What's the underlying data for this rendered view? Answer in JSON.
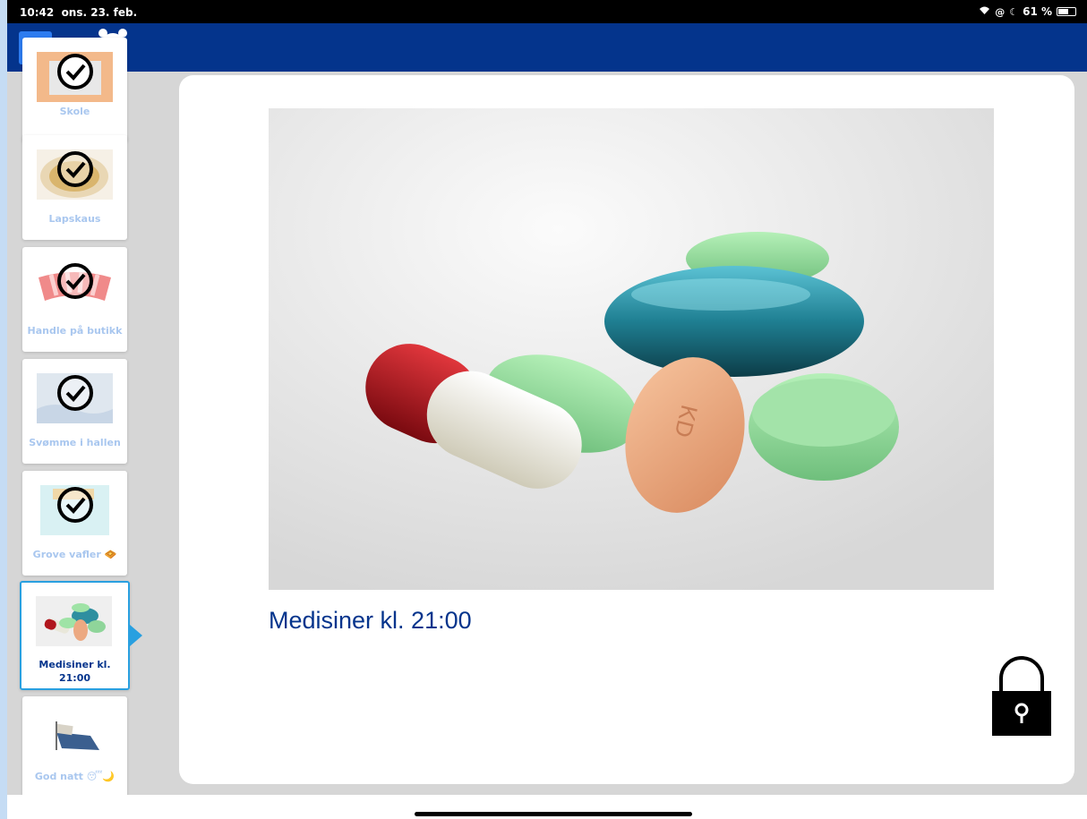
{
  "status_bar": {
    "time": "10:42",
    "date": "ons. 23. feb.",
    "battery": "61 %",
    "battery_level": 0.61
  },
  "app_bar": {
    "back_label": "←",
    "alarm_icon": "alarm-clock-icon",
    "color": "#04348c"
  },
  "sidebar": {
    "items": [
      {
        "label": "Skole",
        "done": true
      },
      {
        "label": "Lapskaus",
        "done": true
      },
      {
        "label": "Handle på butikk",
        "done": true
      },
      {
        "label": "Svømme i hallen",
        "done": true
      },
      {
        "label": "Grove vafler 🧇",
        "done": true
      },
      {
        "label": "Medisiner kl. 21:00",
        "done": false,
        "active": true
      },
      {
        "label": "God natt 😴🌙",
        "done": false
      }
    ],
    "active_color": "#29a0e0"
  },
  "detail": {
    "title": "Medisiner kl. 21:00",
    "lock_icon": "padlock-icon"
  }
}
